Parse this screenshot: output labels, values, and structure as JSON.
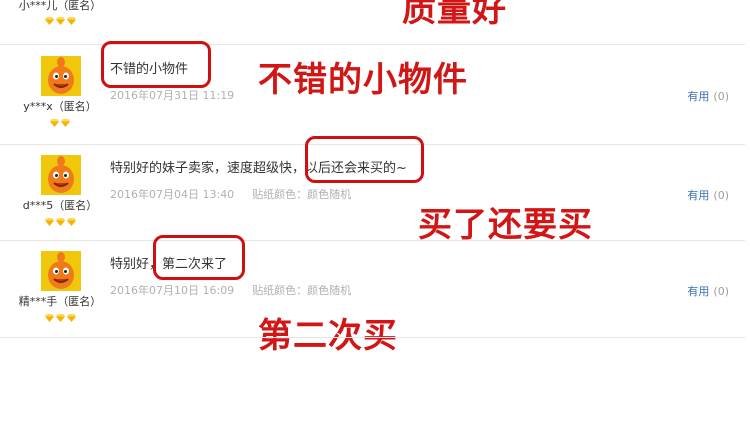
{
  "reviews": [
    {
      "user": "小***儿（匿名）",
      "level_icon": "diamond-icon",
      "diamonds": 3,
      "annotation": "质量好"
    },
    {
      "user": "y***x（匿名）",
      "level_icon": "diamond-icon",
      "diamonds": 2,
      "content": "不错的小物件",
      "date": "2016年07月31日 11:19",
      "attr": "",
      "useful_label": "有用",
      "useful_count": "(0)",
      "annotation": "不错的小物件"
    },
    {
      "user": "d***5（匿名）",
      "level_icon": "diamond-icon",
      "diamonds": 3,
      "content": "特别好的妹子卖家，速度超级快，以后还会来买的~",
      "date": "2016年07月04日 13:40",
      "attr": "贴纸颜色：颜色随机",
      "useful_label": "有用",
      "useful_count": "(0)",
      "annotation": "买了还要买"
    },
    {
      "user": "精***手（匿名）",
      "level_icon": "diamond-icon",
      "diamonds": 3,
      "content": "特别好，第二次来了",
      "date": "2016年07月10日 16:09",
      "attr": "贴纸颜色：颜色随机",
      "useful_label": "有用",
      "useful_count": "(0)",
      "annotation": "第二次买"
    }
  ],
  "colors": {
    "annotation_red": "#d21616",
    "useful_blue": "#3b6fb6",
    "diamond_gold": "#f5b301",
    "avatar_bg": "#f1c70c",
    "avatar_figure": "#f07a1a"
  }
}
